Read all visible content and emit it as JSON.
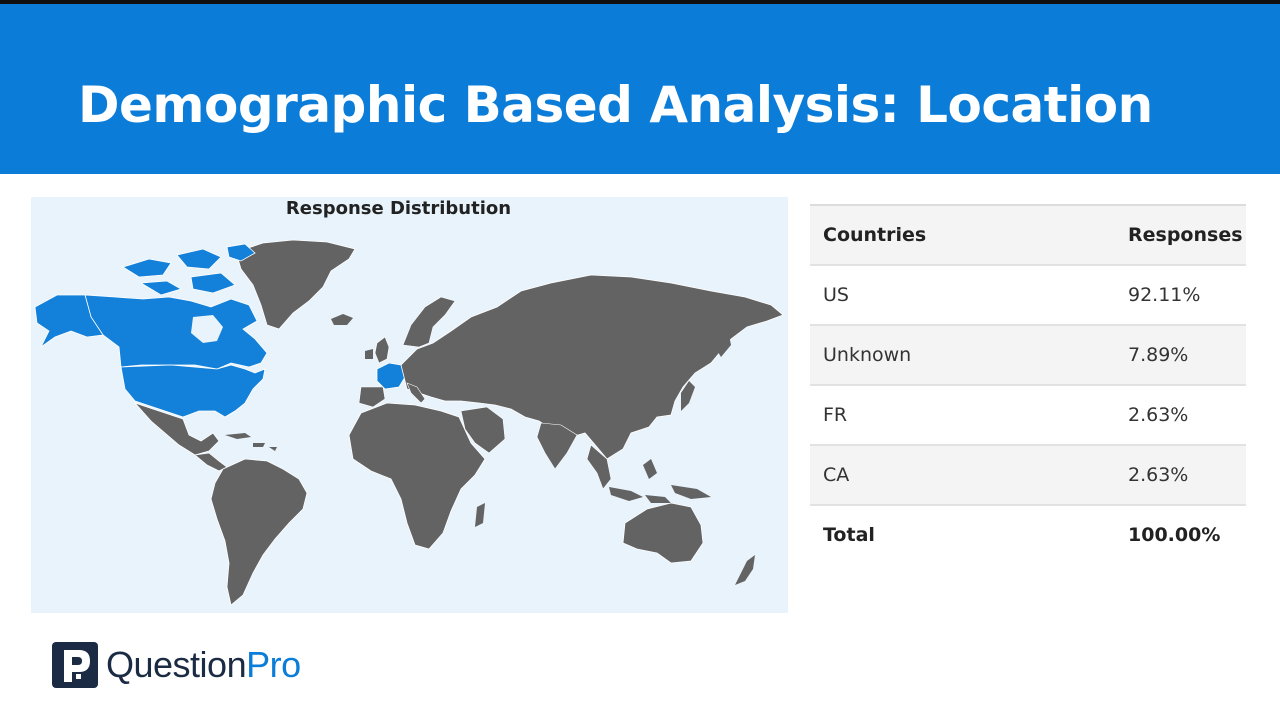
{
  "slide": {
    "title": "Demographic Based Analysis: Location"
  },
  "map": {
    "title": "Response Distribution",
    "highlighted_countries": [
      "US",
      "CA",
      "FR"
    ],
    "colors": {
      "highlighted": "#1380d9",
      "other": "#636363",
      "ocean": "#e8f3fb",
      "borders": "#ffffff"
    }
  },
  "table": {
    "headers": {
      "country": "Countries",
      "responses": "Responses"
    },
    "rows": [
      {
        "country": "US",
        "responses": "92.11%"
      },
      {
        "country": "Unknown",
        "responses": "7.89%"
      },
      {
        "country": "FR",
        "responses": "2.63%"
      },
      {
        "country": "CA",
        "responses": "2.63%"
      }
    ],
    "total": {
      "label": "Total",
      "value": "100.00%"
    }
  },
  "brand": {
    "name_part1": "Question",
    "name_part2": "Pro",
    "icon": "questionpro-logo-icon"
  }
}
